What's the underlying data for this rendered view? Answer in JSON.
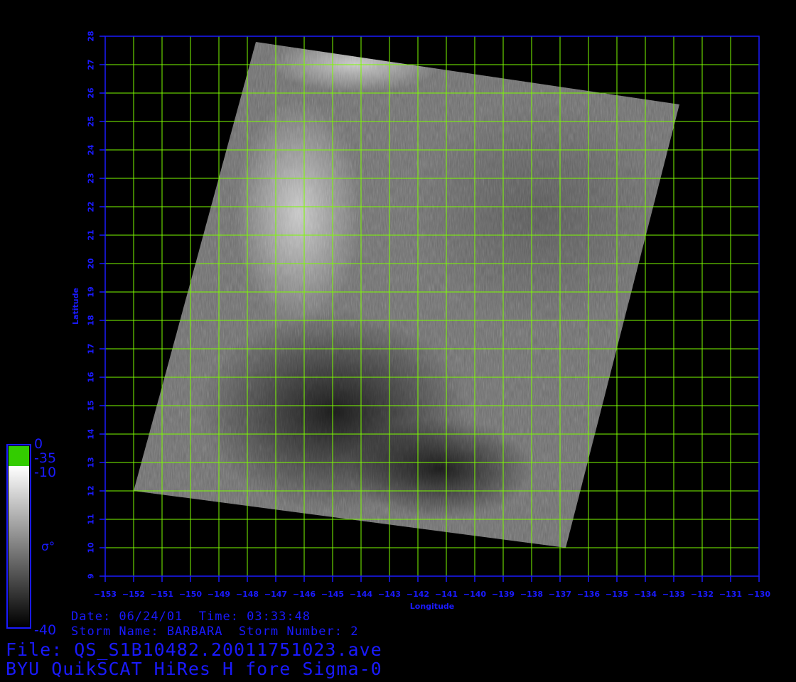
{
  "map": {
    "lon_range": [
      -153,
      -130
    ],
    "lat_range": [
      9,
      28
    ],
    "lon_ticks": [
      -153,
      -152,
      -151,
      -150,
      -149,
      -148,
      -147,
      -146,
      -145,
      -144,
      -143,
      -142,
      -141,
      -140,
      -139,
      -138,
      -137,
      -136,
      -135,
      -134,
      -133,
      -132,
      -131,
      -130
    ],
    "lat_ticks": [
      9,
      10,
      11,
      12,
      13,
      14,
      15,
      16,
      17,
      18,
      19,
      20,
      21,
      22,
      23,
      24,
      25,
      26,
      27,
      28
    ],
    "xlabel": "Longitude",
    "ylabel": "Latitude",
    "swath_corners_lonlat": [
      [
        -147.7,
        27.8
      ],
      [
        -132.8,
        25.6
      ],
      [
        -136.8,
        10.0
      ],
      [
        -152.0,
        12.0
      ]
    ],
    "grid": true,
    "grid_color": "#7CFC00",
    "frame_color": "#1a1aff"
  },
  "colorbar": {
    "label_top": "0",
    "label_green": "-35",
    "label_white": "-10",
    "symbol": "σ°",
    "label_bottom": "-40",
    "colors": {
      "green": "#33cc00",
      "white": "#ffffff",
      "black": "#000000"
    }
  },
  "info": {
    "date_line": "Date: 06/24/01  Time: 03:33:48",
    "storm_line": "Storm Name: BARBARA  Storm Number: 2",
    "file_line": "File: QS_S1B10482.20011751023.ave",
    "product_line": "BYU QuikSCAT HiRes H fore Sigma-0"
  }
}
